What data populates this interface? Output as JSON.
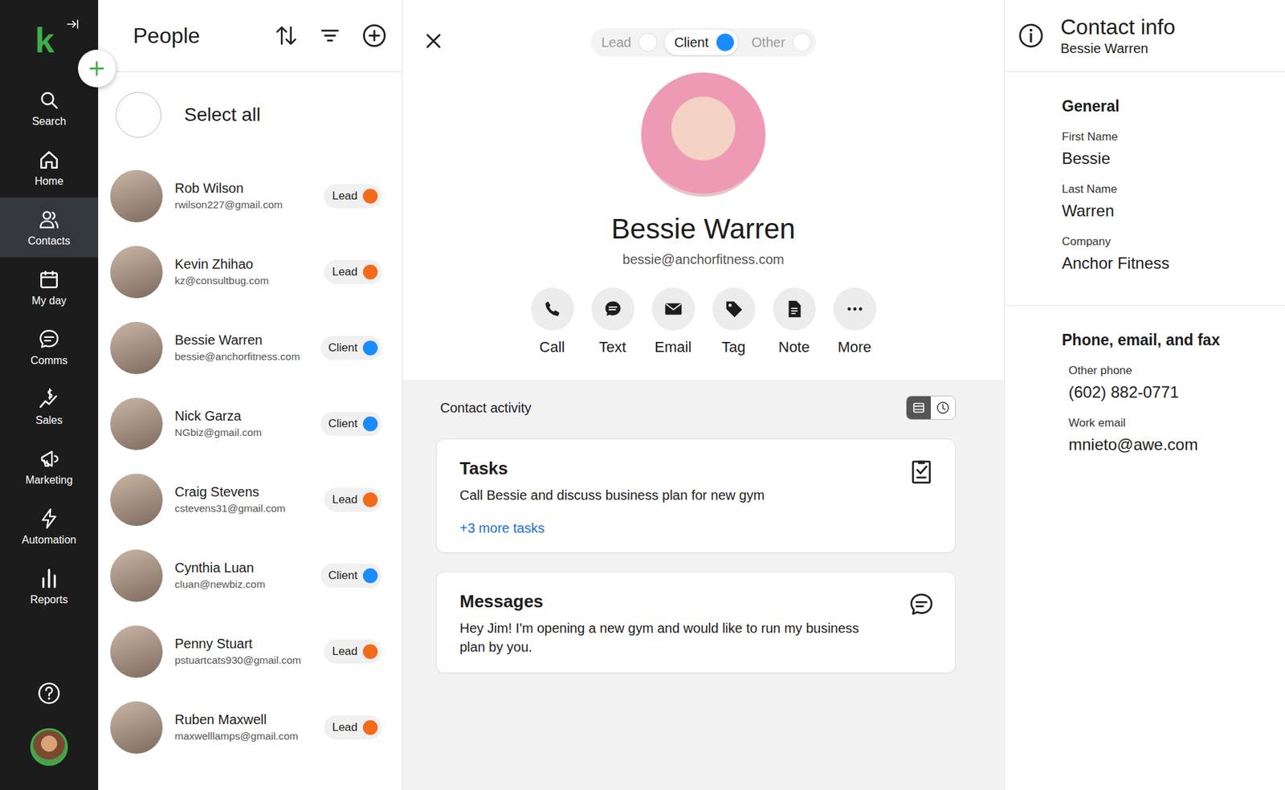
{
  "nav": {
    "logo": "k",
    "items": [
      {
        "label": "Search",
        "kind": "search",
        "selected": false
      },
      {
        "label": "Home",
        "kind": "home",
        "selected": false
      },
      {
        "label": "Contacts",
        "kind": "contacts",
        "selected": true
      },
      {
        "label": "My day",
        "kind": "myday",
        "selected": false
      },
      {
        "label": "Comms",
        "kind": "comms",
        "selected": false
      },
      {
        "label": "Sales",
        "kind": "sales",
        "selected": false
      },
      {
        "label": "Marketing",
        "kind": "marketing",
        "selected": false
      },
      {
        "label": "Automation",
        "kind": "automation",
        "selected": false
      },
      {
        "label": "Reports",
        "kind": "reports",
        "selected": false
      }
    ]
  },
  "people_panel": {
    "title": "People",
    "select_all": "Select all",
    "contacts": [
      {
        "name": "Rob Wilson",
        "email": "rwilson227@gmail.com",
        "status": "Lead",
        "color": "#f26b1d"
      },
      {
        "name": "Kevin Zhihao",
        "email": "kz@consultbug.com",
        "status": "Lead",
        "color": "#f26b1d"
      },
      {
        "name": "Bessie Warren",
        "email": "bessie@anchorfitness.com",
        "status": "Client",
        "color": "#1a8cff"
      },
      {
        "name": "Nick Garza",
        "email": "NGbiz@gmail.com",
        "status": "Client",
        "color": "#1a8cff"
      },
      {
        "name": "Craig Stevens",
        "email": "cstevens31@gmail.com",
        "status": "Lead",
        "color": "#f26b1d"
      },
      {
        "name": "Cynthia Luan",
        "email": "cluan@newbiz.com",
        "status": "Client",
        "color": "#1a8cff"
      },
      {
        "name": "Penny Stuart",
        "email": "pstuartcats930@gmail.com",
        "status": "Lead",
        "color": "#f26b1d"
      },
      {
        "name": "Ruben Maxwell",
        "email": "maxwelllamps@gmail.com",
        "status": "Lead",
        "color": "#f26b1d"
      }
    ]
  },
  "detail": {
    "status_toggle": [
      {
        "label": "Lead",
        "selected": false
      },
      {
        "label": "Client",
        "selected": true
      },
      {
        "label": "Other",
        "selected": false
      }
    ],
    "name": "Bessie Warren",
    "email": "bessie@anchorfitness.com",
    "actions": [
      {
        "label": "Call",
        "kind": "call"
      },
      {
        "label": "Text",
        "kind": "text"
      },
      {
        "label": "Email",
        "kind": "email"
      },
      {
        "label": "Tag",
        "kind": "tag"
      },
      {
        "label": "Note",
        "kind": "note"
      },
      {
        "label": "More",
        "kind": "more"
      }
    ],
    "activity": {
      "title": "Contact activity",
      "views": [
        {
          "kind": "list",
          "selected": true
        },
        {
          "kind": "history",
          "selected": false
        }
      ],
      "cards": [
        {
          "title": "Tasks",
          "kind": "tasks",
          "body": "Call Bessie and discuss business plan for new gym",
          "link": "+3 more tasks"
        },
        {
          "title": "Messages",
          "kind": "messages",
          "body": "Hey Jim! I'm opening a new gym and would like to run my business plan by you."
        }
      ]
    }
  },
  "contact_info": {
    "title": "Contact info",
    "subtitle": "Bessie Warren",
    "sections": [
      {
        "title": "General",
        "fields": [
          {
            "label": "First Name",
            "value": "Bessie"
          },
          {
            "label": "Last Name",
            "value": "Warren"
          },
          {
            "label": "Company",
            "value": "Anchor Fitness"
          }
        ]
      },
      {
        "title": "Phone, email, and fax",
        "fields": [
          {
            "label": "Other phone",
            "value": "(602) 882-0771"
          },
          {
            "label": "Work email",
            "value": "mnieto@awe.com"
          }
        ]
      }
    ]
  }
}
